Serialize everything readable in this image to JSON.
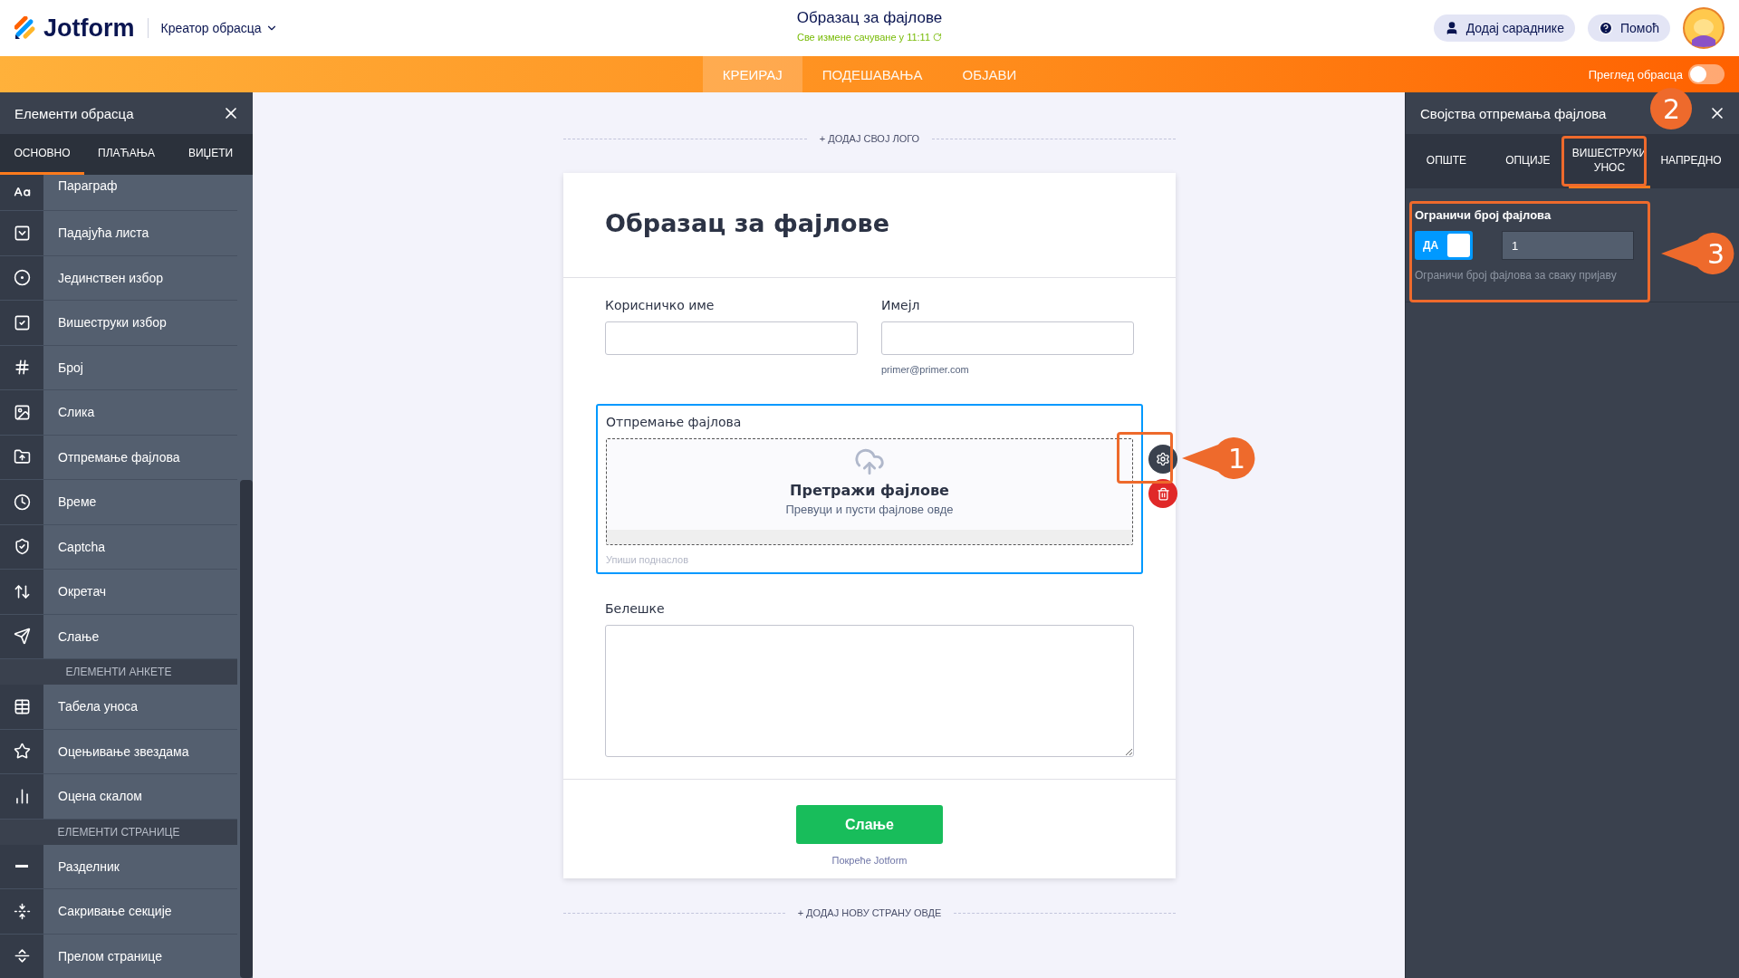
{
  "header": {
    "logo": "Jotform",
    "builder_menu": "Креатор обрасца",
    "form_title": "Образац за фајлове",
    "save_status": "Све измене сачуване у 11:11",
    "buttons": [
      {
        "kind": "people",
        "label": "Додај сараднике"
      },
      {
        "kind": "help",
        "label": "Помоћ"
      }
    ]
  },
  "nav": {
    "tabs": [
      {
        "label": "КРЕИРАЈ",
        "selected": true
      },
      {
        "label": "ПОДЕШАВАЊА",
        "selected": false
      },
      {
        "label": "ОБЈАВИ",
        "selected": false
      }
    ],
    "preview": {
      "label": "Преглед обрасца",
      "on": false
    }
  },
  "left_panel": {
    "title": "Елементи обрасца",
    "tabs": [
      {
        "label": "ОСНОВНО",
        "selected": true
      },
      {
        "label": "ПЛАЋАЊА",
        "selected": false
      },
      {
        "label": "ВИЏЕТИ",
        "selected": false
      }
    ],
    "items": [
      {
        "kind": "item",
        "label": "Параграф"
      },
      {
        "kind": "item",
        "label": "Падајућа листа"
      },
      {
        "kind": "item",
        "label": "Јединствен избор"
      },
      {
        "kind": "item",
        "label": "Вишеструки избор"
      },
      {
        "kind": "item",
        "label": "Број"
      },
      {
        "kind": "item",
        "label": "Слика"
      },
      {
        "kind": "item",
        "label": "Отпремање фајлова"
      },
      {
        "kind": "item",
        "label": "Време"
      },
      {
        "kind": "item",
        "label": "Captcha"
      },
      {
        "kind": "item",
        "label": "Окретач"
      },
      {
        "kind": "item",
        "label": "Слање"
      },
      {
        "kind": "header",
        "label": "ЕЛЕМЕНТИ АНКЕТЕ"
      },
      {
        "kind": "item",
        "label": "Табела уноса"
      },
      {
        "kind": "item",
        "label": "Оцењивање звездама"
      },
      {
        "kind": "item",
        "label": "Оцена скалом"
      },
      {
        "kind": "header",
        "label": "ЕЛЕМЕНТИ СТРАНИЦЕ"
      },
      {
        "kind": "item",
        "label": "Разделник"
      },
      {
        "kind": "item",
        "label": "Сакривање секције"
      },
      {
        "kind": "item",
        "label": "Прелом странице"
      }
    ]
  },
  "canvas": {
    "add_logo": "+ ДОДАЈ СВОЈ ЛОГО",
    "form": {
      "title": "Образац за фајлове",
      "fields": [
        {
          "kind": "text",
          "label": "Корисничко име",
          "selected": false
        },
        {
          "kind": "email",
          "label": "Имејл",
          "sublabel": "primer@primer.com",
          "selected": false
        },
        {
          "kind": "upload",
          "label": "Отпремање фајлова",
          "button": "Претражи фајлове",
          "hint": "Превуци и пусти фајлове овде",
          "sublabel": "Упиши поднаслов",
          "selected": true
        },
        {
          "kind": "textarea",
          "label": "Белешке",
          "selected": false
        }
      ],
      "submit": "Слање",
      "powered_by": "Покреће Jotform"
    },
    "add_page": "+ ДОДАЈ НОВУ СТРАНУ ОВДЕ"
  },
  "right_panel": {
    "title": "Својства отпремања фајлова",
    "tabs": [
      {
        "label": "ОПШТЕ",
        "selected": false
      },
      {
        "label": "ОПЦИЈЕ",
        "selected": false
      },
      {
        "label": "ВИШЕСТРУКИ УНОС",
        "selected": true
      },
      {
        "label": "НАПРЕДНО",
        "selected": false
      }
    ],
    "setting": {
      "label": "Ограничи број фајлова",
      "toggle": {
        "label": "ДА",
        "on": true
      },
      "value": "1",
      "description": "Ограничи број фајлова за сваку пријаву"
    }
  },
  "callouts": [
    "1",
    "2",
    "3"
  ]
}
